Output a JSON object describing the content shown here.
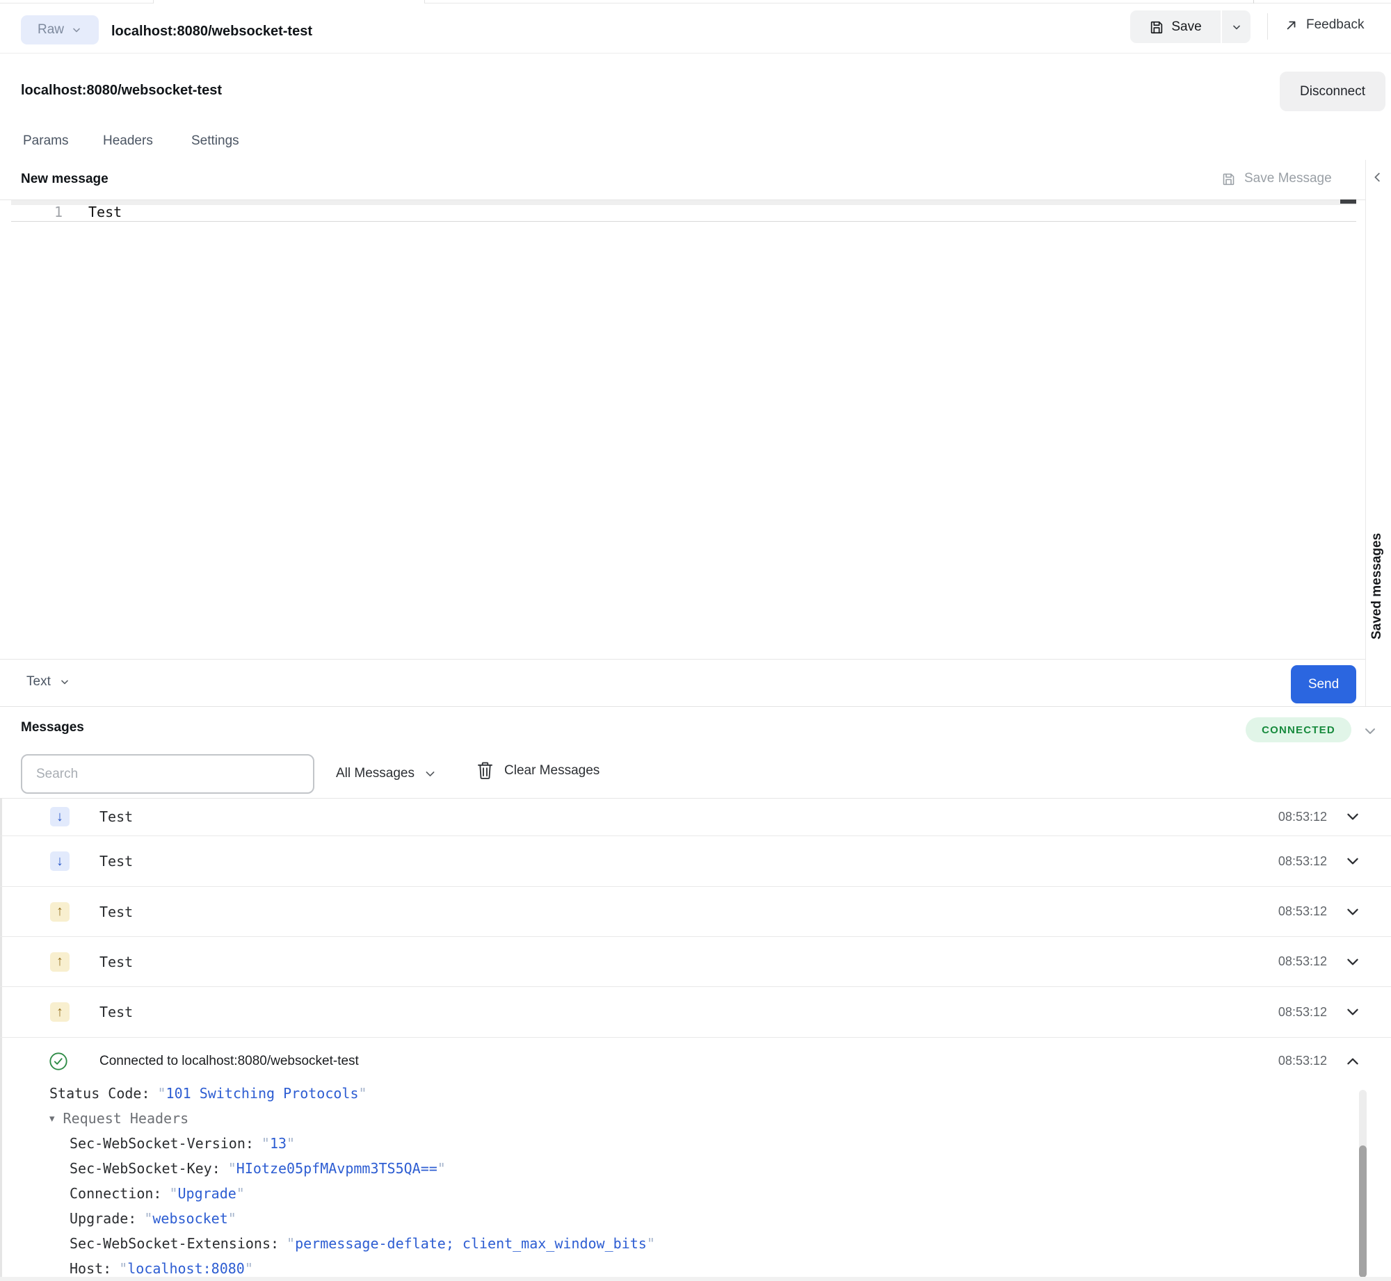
{
  "header": {
    "raw_label": "Raw",
    "title": "localhost:8080/websocket-test",
    "save_label": "Save",
    "feedback_label": "Feedback"
  },
  "request": {
    "url": "localhost:8080/websocket-test",
    "disconnect_label": "Disconnect",
    "tabs": [
      "Params",
      "Headers",
      "Settings"
    ]
  },
  "composer": {
    "heading": "New message",
    "save_message_label": "Save Message",
    "line_number": "1",
    "message_text": "Test",
    "format_label": "Text",
    "send_label": "Send"
  },
  "saved_panel": {
    "label": "Saved messages"
  },
  "messages": {
    "heading": "Messages",
    "connection_status": "CONNECTED",
    "search_placeholder": "Search",
    "filter_label": "All Messages",
    "clear_label": "Clear Messages",
    "rows": [
      {
        "direction": "received",
        "text": "Test",
        "time": "08:53:12"
      },
      {
        "direction": "received",
        "text": "Test",
        "time": "08:53:12"
      },
      {
        "direction": "sent",
        "text": "Test",
        "time": "08:53:12"
      },
      {
        "direction": "sent",
        "text": "Test",
        "time": "08:53:12"
      },
      {
        "direction": "sent",
        "text": "Test",
        "time": "08:53:12"
      },
      {
        "direction": "connected",
        "text": "Connected to localhost:8080/websocket-test",
        "time": "08:53:12",
        "expanded": true
      }
    ],
    "connection_details": {
      "status_code_label": "Status Code:",
      "status_code_value": "101 Switching Protocols",
      "request_headers_label": "Request Headers",
      "headers": [
        {
          "name": "Sec-WebSocket-Version:",
          "value": "13"
        },
        {
          "name": "Sec-WebSocket-Key:",
          "value": "HIotze05pfMAvpmm3TS5QA=="
        },
        {
          "name": "Connection:",
          "value": "Upgrade"
        },
        {
          "name": "Upgrade:",
          "value": "websocket"
        },
        {
          "name": "Sec-WebSocket-Extensions:",
          "value": "permessage-deflate; client_max_window_bits"
        },
        {
          "name": "Host:",
          "value": "localhost:8080"
        }
      ]
    }
  },
  "colors": {
    "accent_blue": "#2b66e0",
    "received_fg": "#2b59c9",
    "received_bg": "#e2eafc",
    "sent_fg": "#96711f",
    "sent_bg": "#f8efcf",
    "success_green": "#2e8b46",
    "connected_badge_bg": "#e1f5e8",
    "connected_badge_fg": "#178a3d",
    "value_blue": "#2d5dd2",
    "quote_gray": "#a5b4cc"
  }
}
